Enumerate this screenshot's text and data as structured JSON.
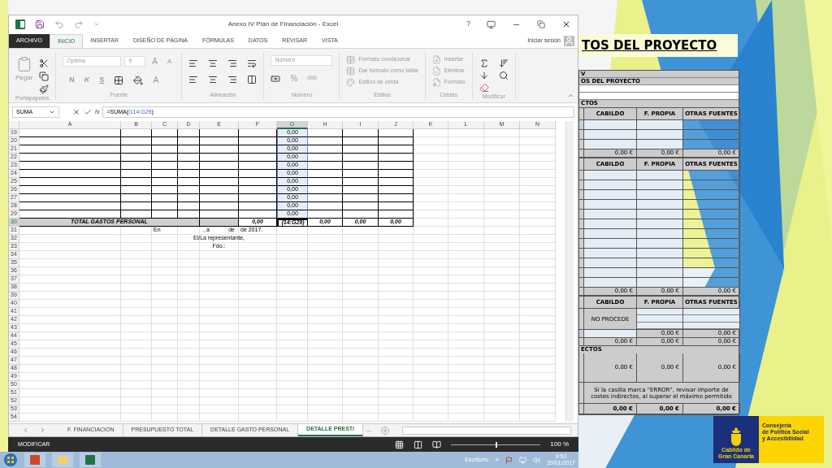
{
  "window": {
    "title": "Anexo IV Plan de Financiación - Excel",
    "help": "?"
  },
  "tabs": [
    {
      "label": "ARCHIVO",
      "kind": "file",
      "selected": false
    },
    {
      "label": "INICIO",
      "kind": "tab",
      "selected": true
    },
    {
      "label": "INSERTAR",
      "kind": "tab",
      "selected": false
    },
    {
      "label": "DISEÑO DE PÁGINA",
      "kind": "tab",
      "selected": false
    },
    {
      "label": "FÓRMULAS",
      "kind": "tab",
      "selected": false
    },
    {
      "label": "DATOS",
      "kind": "tab",
      "selected": false
    },
    {
      "label": "REVISAR",
      "kind": "tab",
      "selected": false
    },
    {
      "label": "VISTA",
      "kind": "tab",
      "selected": false
    }
  ],
  "account": "Iniciar sesión",
  "ribbon": {
    "disabled": true,
    "groups": [
      {
        "kind": "clipboard",
        "label": "Portapapeles",
        "paste": "Pegar"
      },
      {
        "kind": "font",
        "label": "Fuente",
        "font": "Optima",
        "size": "9",
        "bold": "N",
        "italic": "K",
        "underline": "S",
        "grow_label": "A",
        "shrink_label": "A",
        "font_color_label": "A"
      },
      {
        "kind": "alignment",
        "label": "Alineación"
      },
      {
        "kind": "number",
        "label": "Número",
        "format": "Número",
        "percent": "%",
        "thousands": "000"
      },
      {
        "kind": "styles",
        "label": "Estilos",
        "items": [
          "Formato condicional",
          "Dar formato como tabla",
          "Estilos de celda"
        ]
      },
      {
        "kind": "cells",
        "label": "Celdas",
        "items": [
          "Insertar",
          "Eliminar",
          "Formato"
        ]
      },
      {
        "kind": "editing",
        "label": "Modificar"
      }
    ]
  },
  "formula_bar": {
    "name_box": "SUMA",
    "function_label": "fx",
    "prefix": "=SUMA(",
    "reference": "G14:G29",
    "suffix": ")"
  },
  "sheet": {
    "columns": [
      {
        "label": "A",
        "selected": false
      },
      {
        "label": "B",
        "selected": false
      },
      {
        "label": "C",
        "selected": false
      },
      {
        "label": "D",
        "selected": false
      },
      {
        "label": "E",
        "selected": false
      },
      {
        "label": "F",
        "selected": false
      },
      {
        "label": "G",
        "selected": true
      },
      {
        "label": "H",
        "selected": false
      },
      {
        "label": "I",
        "selected": false
      },
      {
        "label": "J",
        "selected": false
      },
      {
        "label": "K",
        "selected": false
      },
      {
        "label": "L",
        "selected": false
      },
      {
        "label": "M",
        "selected": false
      },
      {
        "label": "N",
        "selected": false
      }
    ],
    "rows": [
      {
        "number": "19",
        "kind": "table",
        "selected": false,
        "cells": {
          "G": {
            "texts": [
              "0,00"
            ],
            "highlighted": true,
            "active": false
          }
        }
      },
      {
        "number": "20",
        "kind": "table",
        "selected": false,
        "cells": {
          "G": {
            "texts": [
              "0,00"
            ],
            "highlighted": true,
            "active": false
          }
        }
      },
      {
        "number": "21",
        "kind": "table",
        "selected": false,
        "cells": {
          "G": {
            "texts": [
              "0,00"
            ],
            "highlighted": true,
            "active": false
          }
        }
      },
      {
        "number": "22",
        "kind": "table",
        "selected": false,
        "cells": {
          "G": {
            "texts": [
              "0,00"
            ],
            "highlighted": true,
            "active": false
          }
        }
      },
      {
        "number": "23",
        "kind": "table",
        "selected": false,
        "cells": {
          "G": {
            "texts": [
              "0,00"
            ],
            "highlighted": true,
            "active": false
          }
        }
      },
      {
        "number": "24",
        "kind": "table",
        "selected": false,
        "cells": {
          "G": {
            "texts": [
              "0,00"
            ],
            "highlighted": true,
            "active": false
          }
        }
      },
      {
        "number": "25",
        "kind": "table",
        "selected": false,
        "cells": {
          "G": {
            "texts": [
              "0,00"
            ],
            "highlighted": true,
            "active": false
          }
        }
      },
      {
        "number": "26",
        "kind": "table",
        "selected": false,
        "cells": {
          "G": {
            "texts": [
              "0,00"
            ],
            "highlighted": true,
            "active": false
          }
        }
      },
      {
        "number": "27",
        "kind": "table",
        "selected": false,
        "cells": {
          "G": {
            "texts": [
              "0,00"
            ],
            "highlighted": true,
            "active": false
          }
        }
      },
      {
        "number": "28",
        "kind": "table",
        "selected": false,
        "cells": {
          "G": {
            "texts": [
              "0,00"
            ],
            "highlighted": true,
            "active": false
          }
        }
      },
      {
        "number": "29",
        "kind": "table",
        "selected": false,
        "cells": {
          "G": {
            "texts": [
              "0,00"
            ],
            "highlighted": true,
            "active": false
          }
        }
      },
      {
        "number": "30",
        "kind": "total",
        "selected": true,
        "cells": {
          "A": {
            "texts": [
              "TOTAL GASTOS PERSONAL"
            ],
            "highlighted": false,
            "active": false
          },
          "F": {
            "texts": [
              "0,00"
            ],
            "highlighted": false,
            "active": false
          },
          "G": {
            "texts": [
              "(14:G29)"
            ],
            "highlighted": false,
            "active": true
          },
          "H": {
            "texts": [
              "0,00"
            ],
            "highlighted": false,
            "active": false
          },
          "I": {
            "texts": [
              "0,00"
            ],
            "highlighted": false,
            "active": false
          },
          "J": {
            "texts": [
              "0,00"
            ],
            "highlighted": false,
            "active": false
          }
        }
      },
      {
        "number": "31",
        "kind": "plain",
        "selected": false,
        "cells": {
          "C": {
            "texts": [
              "En"
            ],
            "highlighted": false,
            "active": false
          },
          "E": {
            "texts": [
              ", a",
              "de"
            ],
            "highlighted": false,
            "active": false
          },
          "F": {
            "texts": [
              "de 2017."
            ],
            "highlighted": false,
            "active": false
          }
        }
      },
      {
        "number": "32",
        "kind": "plain",
        "selected": false,
        "cells": {
          "E": {
            "texts": [
              "El/La representante,"
            ],
            "highlighted": false,
            "active": false
          }
        }
      },
      {
        "number": "33",
        "kind": "plain",
        "selected": false,
        "cells": {
          "E": {
            "texts": [
              "Fdo.:"
            ],
            "highlighted": false,
            "active": false
          }
        }
      },
      {
        "number": "34",
        "kind": "plain",
        "selected": false
      },
      {
        "number": "35",
        "kind": "plain",
        "selected": false
      },
      {
        "number": "36",
        "kind": "plain",
        "selected": false
      },
      {
        "number": "37",
        "kind": "plain",
        "selected": false
      },
      {
        "number": "38",
        "kind": "plain",
        "selected": false
      },
      {
        "number": "39",
        "kind": "plain",
        "selected": false
      },
      {
        "number": "40",
        "kind": "plain",
        "selected": false
      },
      {
        "number": "41",
        "kind": "plain",
        "selected": false
      },
      {
        "number": "42",
        "kind": "plain",
        "selected": false
      },
      {
        "number": "43",
        "kind": "plain",
        "selected": false
      },
      {
        "number": "44",
        "kind": "plain",
        "selected": false
      },
      {
        "number": "45",
        "kind": "plain",
        "selected": false
      },
      {
        "number": "46",
        "kind": "plain",
        "selected": false
      },
      {
        "number": "47",
        "kind": "plain",
        "selected": false
      },
      {
        "number": "48",
        "kind": "plain",
        "selected": false
      },
      {
        "number": "49",
        "kind": "plain",
        "selected": false
      },
      {
        "number": "50",
        "kind": "plain",
        "selected": false
      },
      {
        "number": "51",
        "kind": "plain",
        "selected": false
      },
      {
        "number": "52",
        "kind": "plain",
        "selected": false
      },
      {
        "number": "53",
        "kind": "plain",
        "selected": false
      },
      {
        "number": "54",
        "kind": "plain",
        "selected": false
      }
    ]
  },
  "sheet_tabs": [
    {
      "label": "F. FINANCIACION",
      "selected": false
    },
    {
      "label": "PRESUPUESTO TOTAL",
      "selected": false
    },
    {
      "label": "DETALLE GASTO PERSONAL",
      "selected": false
    },
    {
      "label": "DETALLE PREST/",
      "selected": true
    }
  ],
  "more_tabs": "...",
  "status_bar": {
    "mode": "MODIFICAR",
    "zoom": "100 %",
    "level": 0.5
  },
  "taskbar": {
    "desktop": "Escritorio",
    "chevron": "»",
    "time": "9:53",
    "date": "20/01/2017"
  },
  "slide": {
    "title": "TOS DEL PROYECTO",
    "rows": [
      {
        "kind": "header_text",
        "text": "V"
      },
      {
        "kind": "header_text",
        "text": "OS DEL PROYECTO"
      },
      {
        "kind": "blank"
      },
      {
        "kind": "blank"
      },
      {
        "kind": "section",
        "text": "CTOS"
      },
      {
        "kind": "columns",
        "cells": [
          "CABILDO",
          "F. PROPIA",
          "OTRAS FUENTES"
        ]
      },
      {
        "kind": "input"
      },
      {
        "kind": "input"
      },
      {
        "kind": "input"
      },
      {
        "kind": "total",
        "cells": [
          "0,00 €",
          "0,00 €",
          "0,00 €"
        ]
      },
      {
        "kind": "columns",
        "cells": [
          "CABILDO",
          "F. PROPIA",
          "OTRAS FUENTES"
        ]
      },
      {
        "kind": "input"
      },
      {
        "kind": "input"
      },
      {
        "kind": "input"
      },
      {
        "kind": "input"
      },
      {
        "kind": "input"
      },
      {
        "kind": "input"
      },
      {
        "kind": "input"
      },
      {
        "kind": "input"
      },
      {
        "kind": "input"
      },
      {
        "kind": "input"
      },
      {
        "kind": "input"
      },
      {
        "kind": "input"
      },
      {
        "kind": "total",
        "cells": [
          "0,00 €",
          "0,00 €",
          "0,00 €"
        ]
      },
      {
        "kind": "columns",
        "cells": [
          "CABILDO",
          "F. PROPIA",
          "OTRAS FUENTES"
        ]
      },
      {
        "kind": "no_procede",
        "text": "NO PROCEDE"
      },
      {
        "kind": "partial_total",
        "cells": [
          "0,00 €",
          "0,00 €"
        ]
      },
      {
        "kind": "total",
        "cells": [
          "0,00 €",
          "0,00 €",
          "0,00 €"
        ]
      },
      {
        "kind": "section",
        "text": "ECTOS"
      },
      {
        "kind": "big_total",
        "cells": [
          "0,00 €",
          "0,00 €",
          "0,00 €"
        ]
      },
      {
        "kind": "note",
        "text": "Si la casilla marca \"ERROR\", revisar importe de costes indirectos, al superar el máximo permitido"
      },
      {
        "kind": "grand_total",
        "cells": [
          "0,00 €",
          "0,00 €",
          "0,00 €"
        ]
      }
    ]
  },
  "logo": {
    "name": [
      "Cabildo de",
      "Gran Canaria"
    ],
    "department": [
      "Consejería",
      "de Política Social",
      "y Accesibilidad"
    ]
  }
}
